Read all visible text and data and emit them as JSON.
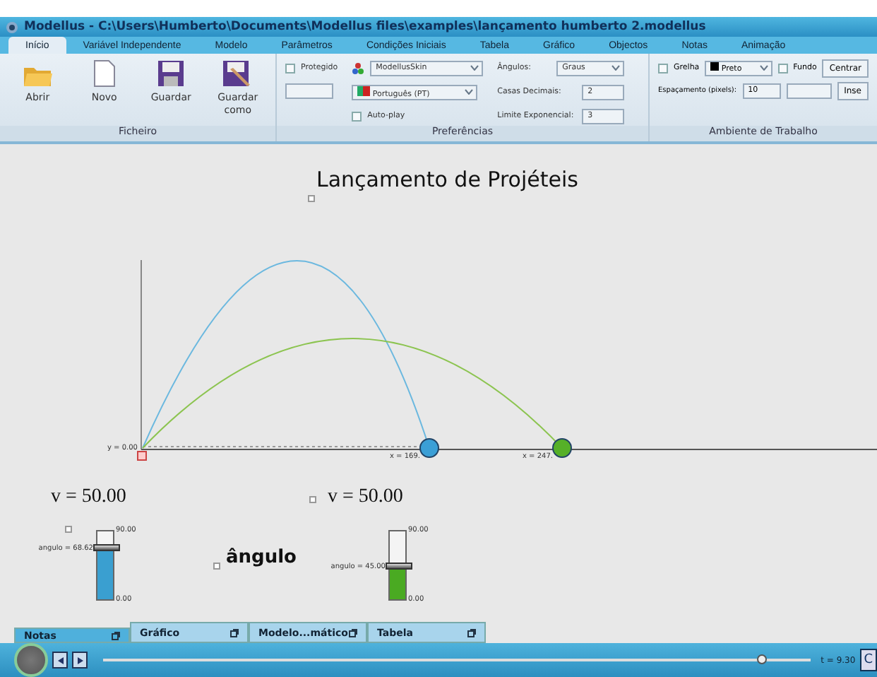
{
  "window": {
    "title": "Modellus - C:\\Users\\Humberto\\Documents\\Modellus files\\examples\\lançamento humberto 2.modellus"
  },
  "ribbon_tabs": [
    {
      "label": "Início",
      "selected": true
    },
    {
      "label": "Variável Independente",
      "selected": false
    },
    {
      "label": "Modelo",
      "selected": false
    },
    {
      "label": "Parâmetros",
      "selected": false
    },
    {
      "label": "Condições Iniciais",
      "selected": false
    },
    {
      "label": "Tabela",
      "selected": false
    },
    {
      "label": "Gráfico",
      "selected": false
    },
    {
      "label": "Objectos",
      "selected": false
    },
    {
      "label": "Notas",
      "selected": false
    },
    {
      "label": "Animação",
      "selected": false
    }
  ],
  "ficheiro": {
    "label": "Ficheiro",
    "buttons": [
      {
        "kind": "open",
        "label": "Abrir"
      },
      {
        "kind": "new",
        "label": "Novo"
      },
      {
        "kind": "save",
        "label": "Guardar"
      },
      {
        "kind": "saveas",
        "label": "Guardar como"
      }
    ]
  },
  "preferences": {
    "label": "Preferências",
    "protected": {
      "label": "Protegido",
      "checked": false
    },
    "skin": "ModellusSkin",
    "language": "Português (PT)",
    "autoplay": {
      "label": "Auto-play",
      "checked": false
    },
    "angles": {
      "label": "Ângulos:",
      "value": "Graus"
    },
    "decimals": {
      "label": "Casas Decimais:",
      "value": "2"
    },
    "exponent": {
      "label": "Limite Exponencial:",
      "value": "3"
    }
  },
  "workspace": {
    "label": "Ambiente de Trabalho",
    "grid": {
      "label": "Grelha",
      "checked": false
    },
    "grid_color": {
      "label": "Preto",
      "color": "#000000"
    },
    "background": {
      "label": "Fundo",
      "checked": false
    },
    "center_button": "Centrar",
    "spacing": {
      "label": "Espaçamento (pixels):",
      "value": "10"
    },
    "insert_button": "Inse"
  },
  "canvas": {
    "title": "Lançamento de Projéteis",
    "y_label": "y = 0.00",
    "x_labels": [
      "x = 169.",
      "x = 247."
    ],
    "velocities": [
      "v = 50.00",
      "v = 50.00"
    ],
    "angle_caption": "ângulo",
    "sliders": [
      {
        "label": "angulo = 68.62",
        "max": "90.00",
        "min": "0.00",
        "level": 0.762,
        "color": "#3a9fd0"
      },
      {
        "label": "angulo = 45.00",
        "max": "90.00",
        "min": "0.00",
        "level": 0.5,
        "color": "#4aaa22"
      }
    ]
  },
  "bottom_tabs": [
    {
      "label": "Notas",
      "selected": true
    },
    {
      "label": "Gráfico",
      "selected": false
    },
    {
      "label": "Modelo...mático",
      "selected": false
    },
    {
      "label": "Tabela",
      "selected": false
    }
  ],
  "player": {
    "level": 0.93,
    "time": "t = 9.30",
    "edge_button": "C"
  }
}
